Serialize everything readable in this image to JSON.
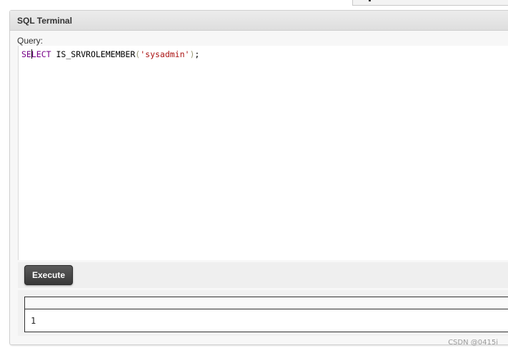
{
  "panel": {
    "title": "SQL Terminal",
    "query_label": "Query:"
  },
  "editor": {
    "query_text": "SELECT IS_SRVROLEMEMBER('sysadmin');",
    "tokens": {
      "keyword_before_cursor": "SE",
      "keyword_after_cursor": "LECT",
      "space": " ",
      "function": "IS_SRVROLEMEMBER",
      "open_paren": "(",
      "string": "'sysadmin'",
      "close_paren": ")",
      "semicolon": ";"
    }
  },
  "actions": {
    "execute_label": "Execute"
  },
  "result": {
    "columns": [
      ""
    ],
    "rows": [
      [
        "1"
      ]
    ]
  },
  "watermark": "CSDN @0415i",
  "colors": {
    "keyword": "#770088",
    "string": "#aa1111",
    "button": "#444444"
  }
}
